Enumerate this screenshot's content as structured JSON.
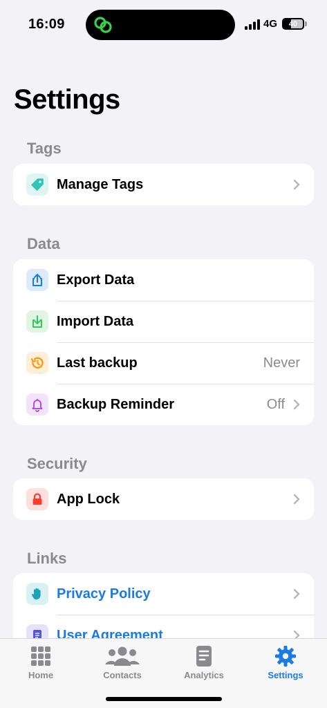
{
  "status_bar": {
    "time": "16:09",
    "network": "4G",
    "battery": "40",
    "battery_level": 0.4
  },
  "page": {
    "title": "Settings"
  },
  "sections": {
    "tags": {
      "header": "Tags",
      "rows": [
        {
          "label": "Manage Tags",
          "icon": "tag-icon",
          "color": "#2ec4b6"
        }
      ]
    },
    "data": {
      "header": "Data",
      "rows": [
        {
          "label": "Export Data",
          "icon": "share-export-icon",
          "color": "#1a7be4"
        },
        {
          "label": "Import Data",
          "icon": "import-icon",
          "color": "#34c759"
        },
        {
          "label": "Last backup",
          "value": "Never",
          "icon": "history-clock-icon",
          "color": "#ff9500"
        },
        {
          "label": "Backup Reminder",
          "value": "Off",
          "icon": "bell-icon",
          "color": "#af52de"
        }
      ]
    },
    "security": {
      "header": "Security",
      "rows": [
        {
          "label": "App Lock",
          "icon": "lock-icon",
          "color": "#ff3b30"
        }
      ]
    },
    "links": {
      "header": "Links",
      "rows": [
        {
          "label": "Privacy Policy",
          "icon": "hand-icon",
          "color": "#1ca3b8"
        },
        {
          "label": "User Agreement",
          "icon": "document-icon",
          "color": "#5856d6"
        }
      ]
    }
  },
  "tab_bar": {
    "tabs": [
      {
        "label": "Home",
        "icon": "grid-icon",
        "active": false
      },
      {
        "label": "Contacts",
        "icon": "people-icon",
        "active": false
      },
      {
        "label": "Analytics",
        "icon": "report-icon",
        "active": false
      },
      {
        "label": "Settings",
        "icon": "gear-icon",
        "active": true
      }
    ]
  },
  "colors": {
    "accent": "#1a7be4",
    "background": "#f2f2f7",
    "secondary_text": "#8a8a8e"
  }
}
